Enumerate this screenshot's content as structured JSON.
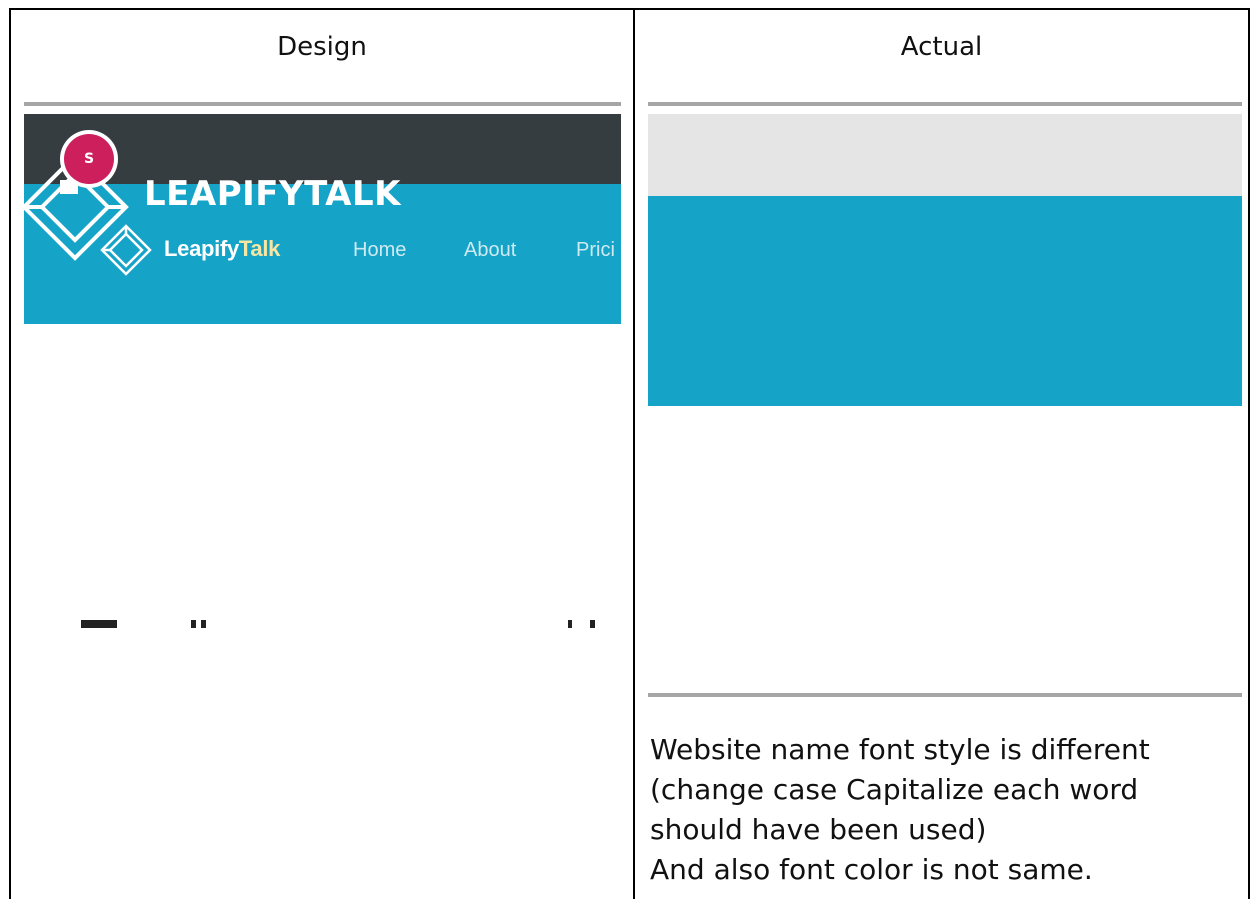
{
  "columns": {
    "design_label": "Design",
    "actual_label": "Actual"
  },
  "design": {
    "brand_leapify": "Leapify",
    "brand_talk": "Talk",
    "logo_icon": "diamond-logo-icon",
    "nav": [
      "Home",
      "About",
      "Prici"
    ],
    "colors": {
      "topbar": "#363d40",
      "navbar": "#15a4c8",
      "brand_accent": "#f5e6a3"
    }
  },
  "actual": {
    "brand": "LEAPIFYTALK",
    "avatar_letter": "S",
    "logo_icon": "diamond-logo-icon",
    "colors": {
      "topbar": "#e5e5e5",
      "navbar": "#15a4c8",
      "avatar": "#cc1f5c"
    }
  },
  "note": {
    "lines": [
      "Website name font style is different",
      "(change case Capitalize each word",
      "should have been used)",
      "And also font color is not same."
    ]
  }
}
